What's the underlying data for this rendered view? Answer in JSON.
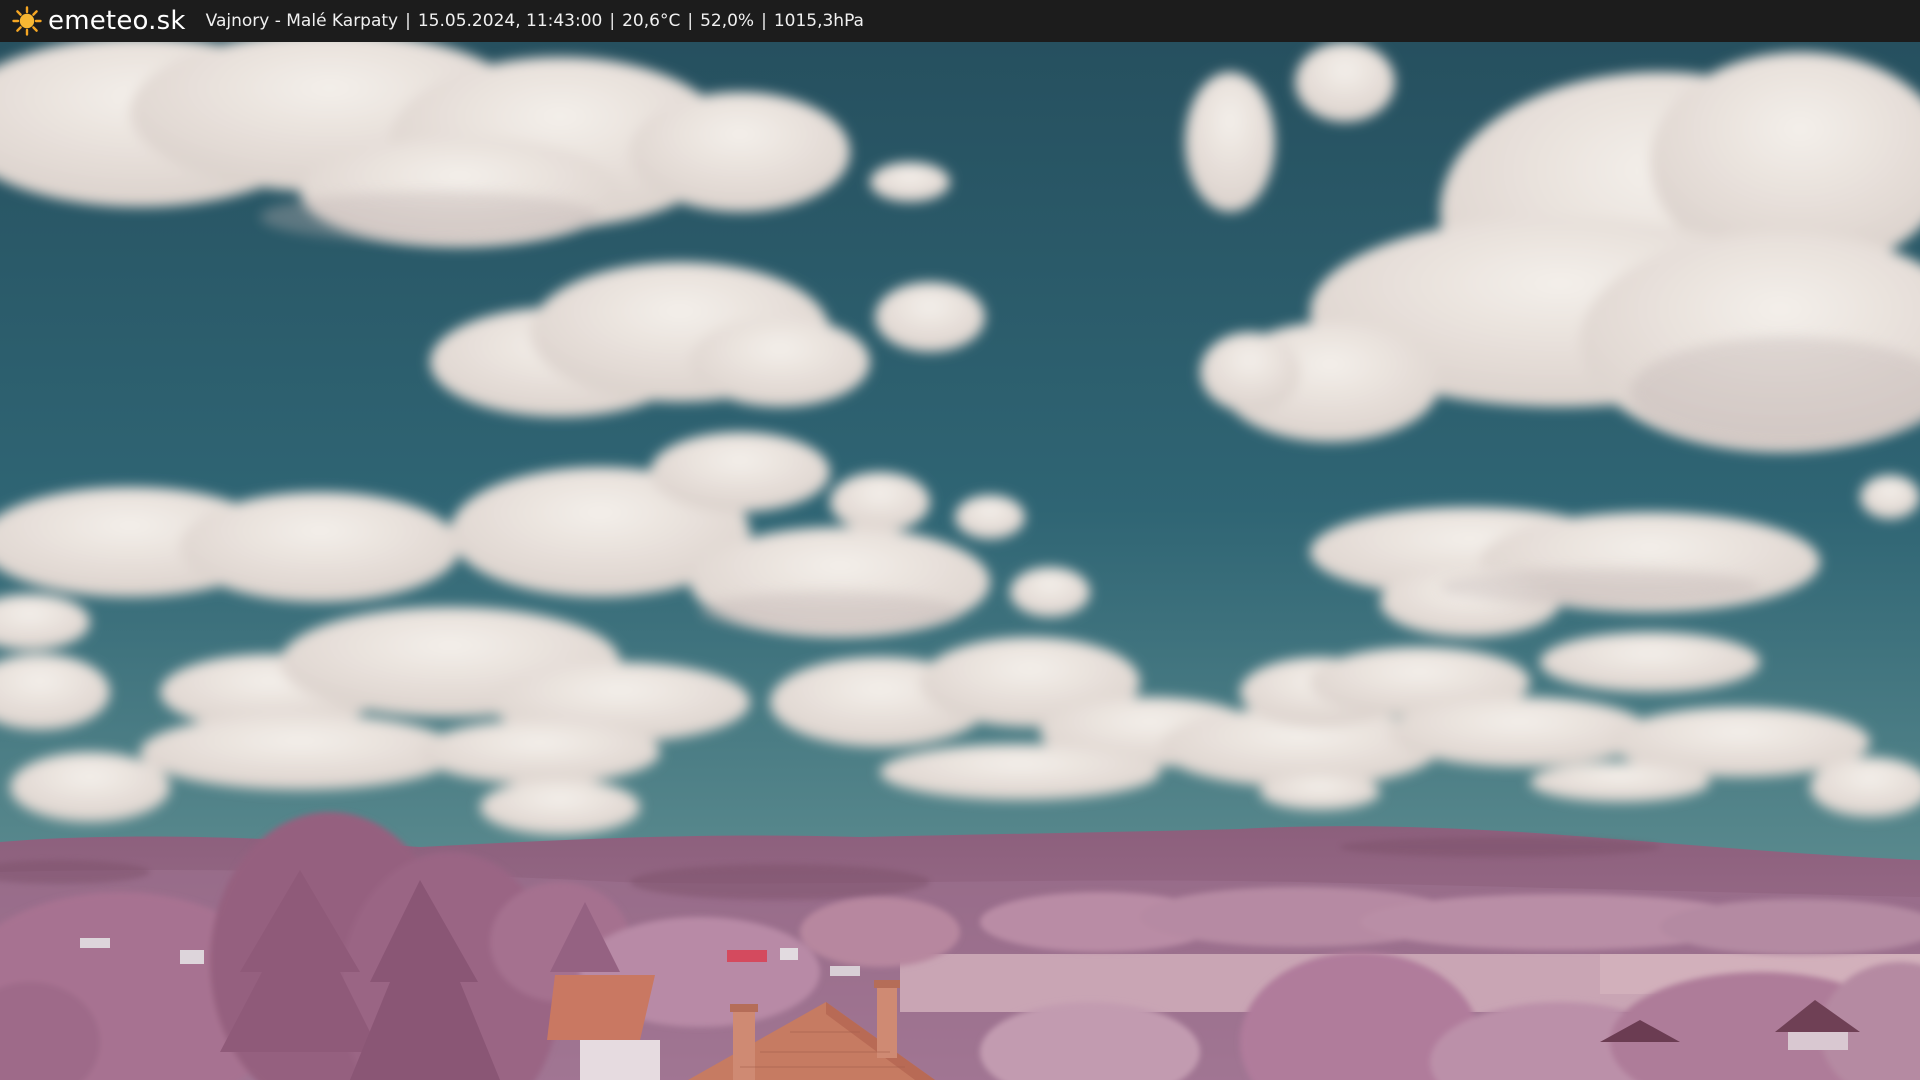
{
  "header": {
    "brand": "emeteo.sk",
    "brand_icon": "sun-icon",
    "station": "Vajnory - Malé Karpaty",
    "datetime": "15.05.2024, 11:43:00",
    "temperature": "20,6°C",
    "humidity": "52,0%",
    "pressure": "1015,3hPa",
    "separator": "|"
  },
  "colors": {
    "bar_background": "#1c1c1c",
    "sun": "#f5a623",
    "sky_top": "#2a5468",
    "sky_bottom": "#5e8f95",
    "foliage": "#b07f9c",
    "roof": "#c47a5f"
  }
}
